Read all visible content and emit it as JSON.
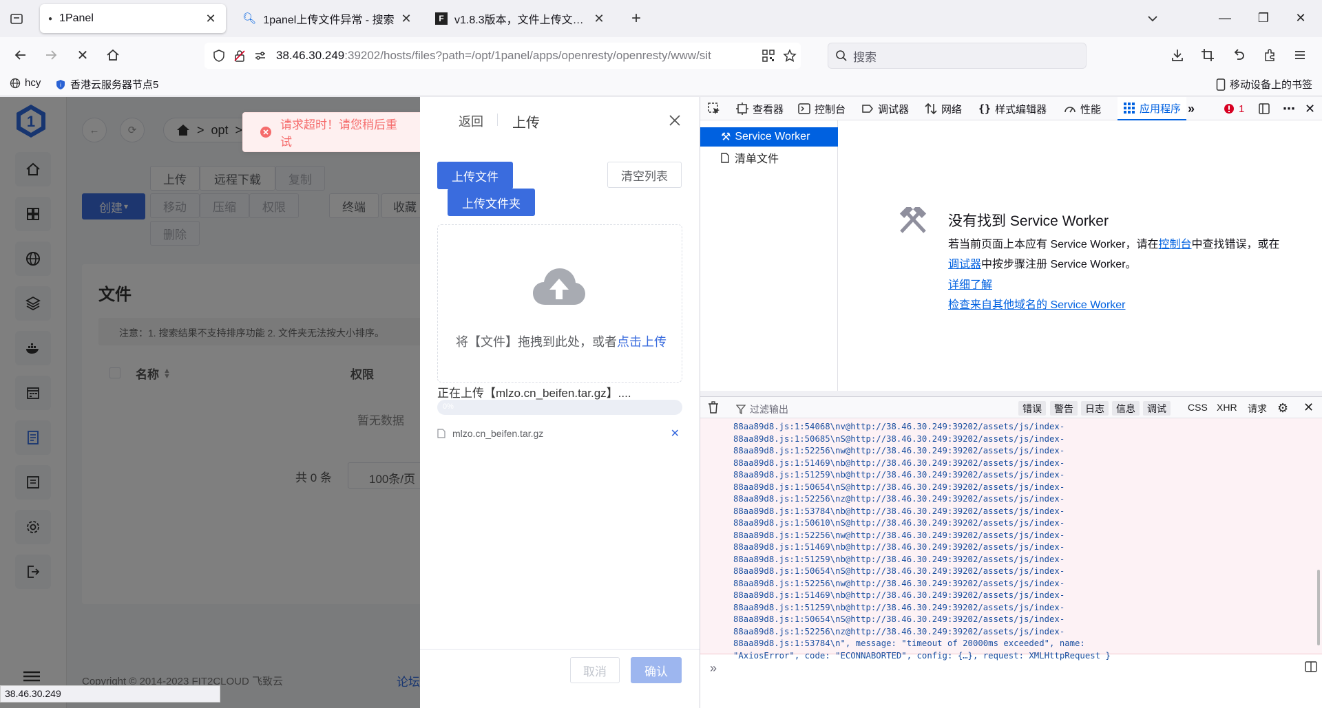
{
  "browser": {
    "tabs": [
      {
        "title": "1Panel",
        "active": true
      },
      {
        "title": "1panel上传文件异常 - 搜索",
        "active": false
      },
      {
        "title": "v1.8.3版本，文件上传文件夹时",
        "active": false
      }
    ],
    "url_host": "38.46.30.249",
    "url_rest": ":39202/hosts/files?path=/opt/1panel/apps/openresty/openresty/www/sit",
    "search_placeholder": "搜索",
    "bookmarks": [
      "hcy",
      "香港云服务器节点5"
    ],
    "mobile_bookmarks": "移动设备上的书签",
    "status_url": "38.46.30.249"
  },
  "app": {
    "breadcrumb": [
      "opt"
    ],
    "toolbar": {
      "upload": "上传",
      "remote_download": "远程下载",
      "copy": "复制",
      "create": "创建",
      "move": "移动",
      "compress": "压缩",
      "permission": "权限",
      "delete": "删除",
      "terminal": "终端",
      "favorite": "收藏"
    },
    "section_title": "文件",
    "notice": "注意：1. 搜索结果不支持排序功能 2. 文件夹无法按大小排序。",
    "columns": {
      "name": "名称",
      "permission": "权限"
    },
    "empty": "暂无数据",
    "total": "共 0 条",
    "page_size": "100条/页",
    "copyright": "Copyright © 2014-2023 FIT2CLOUD 飞致云",
    "forum": "论坛"
  },
  "toast": {
    "message": "请求超时！请您稍后重试",
    "color": "#f56c6c"
  },
  "drawer": {
    "back": "返回",
    "title": "上传",
    "upload_file": "上传文件",
    "upload_folder": "上传文件夹",
    "clear_list": "清空列表",
    "drop_text": "将【文件】拖拽到此处，或者",
    "click_upload": "点击上传",
    "uploading": "正在上传【mlzo.cn_beifen.tar.gz】....",
    "progress_label": "0%",
    "progress": 0,
    "file_name": "mlzo.cn_beifen.tar.gz",
    "cancel": "取消",
    "confirm": "确认",
    "accent": "#3a6cde"
  },
  "devtools": {
    "tabs": [
      "查看器",
      "控制台",
      "调试器",
      "网络",
      "样式编辑器",
      "性能",
      "应用程序"
    ],
    "active_tab": "应用程序",
    "error_count": "1",
    "sidebar": [
      "Service Worker",
      "清单文件"
    ],
    "sw": {
      "title": "没有找到 Service Worker",
      "line1_a": "若当前页面上本应有 Service Worker，请在",
      "line1_link": "控制台",
      "line1_b": "中查找错误，或在",
      "line2_link": "调试器",
      "line2_b": "中按步骤注册 Service Worker。",
      "learn_more": "详细了解",
      "other_domains": "检查来自其他域名的 Service Worker"
    },
    "console": {
      "filter_placeholder": "过滤输出",
      "levels": [
        "错误",
        "警告",
        "日志",
        "信息",
        "调试"
      ],
      "types": [
        "CSS",
        "XHR",
        "请求"
      ],
      "log": "88aa89d8.js:1:54068\\nv@http://38.46.30.249:39202/assets/js/index-\n88aa89d8.js:1:50685\\nS@http://38.46.30.249:39202/assets/js/index-\n88aa89d8.js:1:52256\\nw@http://38.46.30.249:39202/assets/js/index-\n88aa89d8.js:1:51469\\nb@http://38.46.30.249:39202/assets/js/index-\n88aa89d8.js:1:51259\\nb@http://38.46.30.249:39202/assets/js/index-\n88aa89d8.js:1:50654\\nS@http://38.46.30.249:39202/assets/js/index-\n88aa89d8.js:1:52256\\nz@http://38.46.30.249:39202/assets/js/index-\n88aa89d8.js:1:53784\\nb@http://38.46.30.249:39202/assets/js/index-\n88aa89d8.js:1:50610\\nS@http://38.46.30.249:39202/assets/js/index-\n88aa89d8.js:1:52256\\nw@http://38.46.30.249:39202/assets/js/index-\n88aa89d8.js:1:51469\\nb@http://38.46.30.249:39202/assets/js/index-\n88aa89d8.js:1:51259\\nb@http://38.46.30.249:39202/assets/js/index-\n88aa89d8.js:1:50654\\nS@http://38.46.30.249:39202/assets/js/index-\n88aa89d8.js:1:52256\\nw@http://38.46.30.249:39202/assets/js/index-\n88aa89d8.js:1:51469\\nb@http://38.46.30.249:39202/assets/js/index-\n88aa89d8.js:1:51259\\nb@http://38.46.30.249:39202/assets/js/index-\n88aa89d8.js:1:50654\\nS@http://38.46.30.249:39202/assets/js/index-\n88aa89d8.js:1:52256\\nz@http://38.46.30.249:39202/assets/js/index-\n88aa89d8.js:1:53784\\n\", message: \"timeout of 20000ms exceeded\", name:\n\"AxiosError\", code: \"ECONNABORTED\", config: {…}, request: XMLHttpRequest }"
    }
  }
}
